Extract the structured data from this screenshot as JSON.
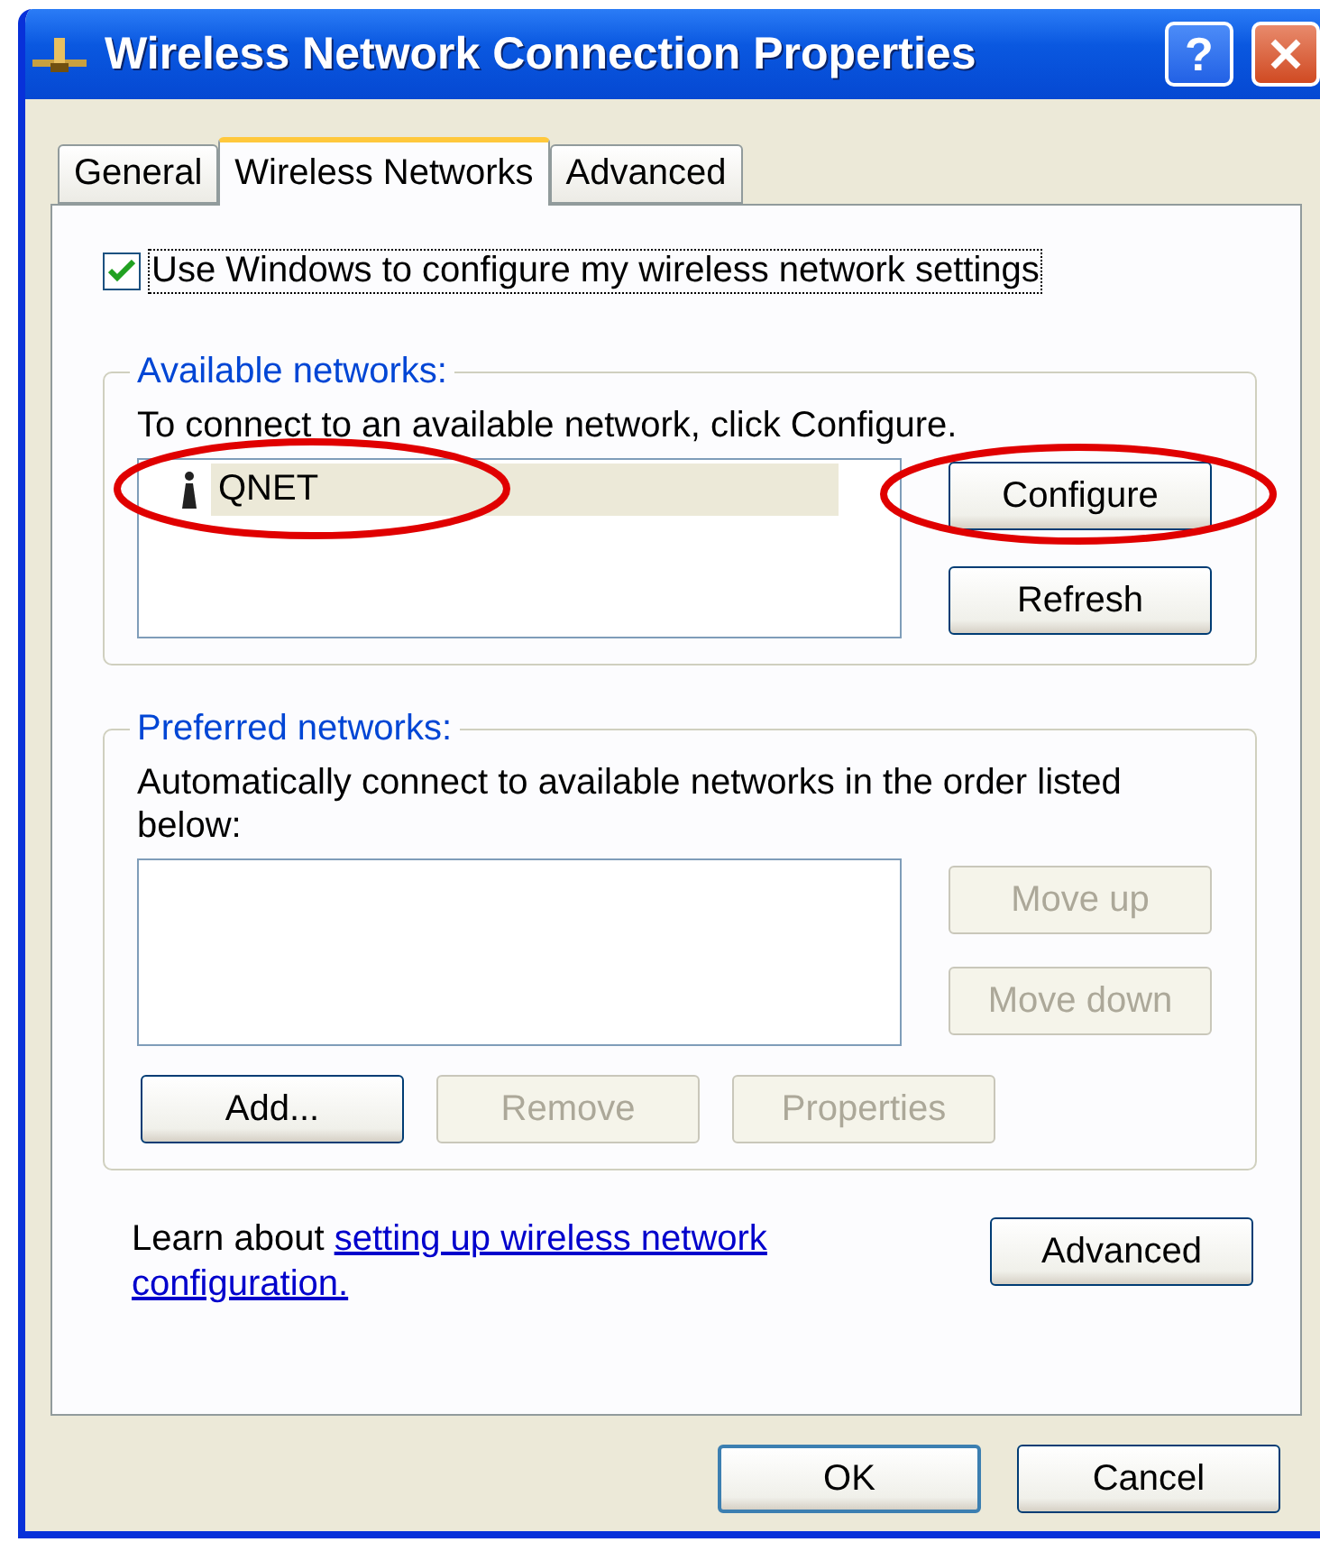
{
  "window": {
    "title": "Wireless Network Connection Properties",
    "help_button": "?"
  },
  "tabs": [
    {
      "label": "General",
      "selected": false
    },
    {
      "label": "Wireless Networks",
      "selected": true
    },
    {
      "label": "Advanced",
      "selected": false
    }
  ],
  "use_windows_checkbox": {
    "label": "Use Windows to configure my wireless network settings",
    "checked": true
  },
  "available_networks": {
    "legend": "Available networks:",
    "instruction": "To connect to an available network, click Configure.",
    "networks": [
      {
        "name": "QNET",
        "selected": true,
        "highlighted": true
      }
    ],
    "buttons": [
      {
        "label": "Configure",
        "disabled": false,
        "highlighted": true
      },
      {
        "label": "Refresh",
        "disabled": false,
        "highlighted": false
      }
    ]
  },
  "preferred_networks": {
    "legend": "Preferred networks:",
    "instruction": "Automatically connect to available networks in the order listed below:",
    "side_buttons": [
      {
        "label": "Move up",
        "disabled": true
      },
      {
        "label": "Move down",
        "disabled": true
      }
    ],
    "bottom_buttons": [
      {
        "label": "Add...",
        "disabled": false
      },
      {
        "label": "Remove",
        "disabled": true
      },
      {
        "label": "Properties",
        "disabled": true
      }
    ]
  },
  "learn_more": {
    "text": "Learn about",
    "link_lines": [
      "setting up wireless network",
      "configuration."
    ]
  },
  "advanced_button": {
    "label": "Advanced",
    "disabled": false
  },
  "footer_buttons": [
    {
      "label": "OK",
      "default": true
    },
    {
      "label": "Cancel",
      "default": false
    }
  ]
}
